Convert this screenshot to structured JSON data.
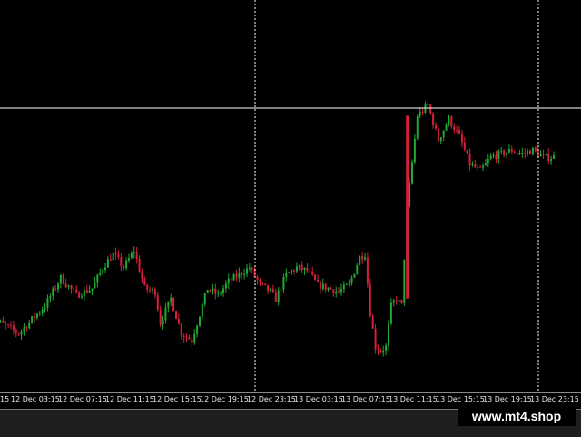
{
  "colors": {
    "background": "#000000",
    "bull": "#22a832",
    "bear": "#d81e3c",
    "grid": "#ffffff",
    "crosshair": "#ffffff",
    "axis_text": "#e6e6e6"
  },
  "chart_data": {
    "type": "candlestick",
    "x_tick_labels": [
      "12 Dec 03:15",
      "12 Dec 07:15",
      "12 Dec 11:15",
      "12 Dec 15:15",
      "12 Dec 19:15",
      "12 Dec 23:15",
      "13 Dec 03:15",
      "13 Dec 07:15",
      "13 Dec 11:15",
      "13 Dec 15:15",
      "13 Dec 19:15",
      "13 Dec 23:15"
    ],
    "x_tick_label_partial_left": "15",
    "period_separators": [
      "12 Dec 23:15",
      "13 Dec 23:15"
    ],
    "crosshair_visible": true,
    "grid": false,
    "price_trace": [
      {
        "t": 0,
        "v": 19
      },
      {
        "t": 6,
        "v": 14
      },
      {
        "t": 11,
        "v": 22
      },
      {
        "t": 14,
        "v": 30
      },
      {
        "t": 17,
        "v": 25
      },
      {
        "t": 20,
        "v": 27
      },
      {
        "t": 22,
        "v": 33
      },
      {
        "t": 24,
        "v": 37
      },
      {
        "t": 26,
        "v": 33
      },
      {
        "t": 28,
        "v": 38
      },
      {
        "t": 30,
        "v": 27
      },
      {
        "t": 32,
        "v": 26
      },
      {
        "t": 33,
        "v": 17
      },
      {
        "t": 35,
        "v": 24
      },
      {
        "t": 37,
        "v": 14
      },
      {
        "t": 39,
        "v": 12
      },
      {
        "t": 41,
        "v": 22
      },
      {
        "t": 42,
        "v": 27
      },
      {
        "t": 44,
        "v": 25
      },
      {
        "t": 46,
        "v": 29
      },
      {
        "t": 48,
        "v": 31
      },
      {
        "t": 50,
        "v": 33
      },
      {
        "t": 52,
        "v": 28
      },
      {
        "t": 54,
        "v": 26
      },
      {
        "t": 55,
        "v": 24
      },
      {
        "t": 57,
        "v": 31
      },
      {
        "t": 59,
        "v": 33
      },
      {
        "t": 61,
        "v": 32
      },
      {
        "t": 63,
        "v": 28
      },
      {
        "t": 65,
        "v": 27
      },
      {
        "t": 67,
        "v": 26
      },
      {
        "t": 69,
        "v": 28
      },
      {
        "t": 70,
        "v": 32
      },
      {
        "t": 71,
        "v": 36
      },
      {
        "t": 72,
        "v": 37
      },
      {
        "t": 73,
        "v": 20
      },
      {
        "t": 74,
        "v": 10
      },
      {
        "t": 75,
        "v": 9
      },
      {
        "t": 76,
        "v": 10
      },
      {
        "t": 77,
        "v": 22
      },
      {
        "t": 78,
        "v": 24
      },
      {
        "t": 79,
        "v": 22
      },
      {
        "t": 80,
        "v": 50
      },
      {
        "t": 82,
        "v": 77
      },
      {
        "t": 84,
        "v": 80
      },
      {
        "t": 86,
        "v": 70
      },
      {
        "t": 88,
        "v": 76
      },
      {
        "t": 90,
        "v": 71
      },
      {
        "t": 92,
        "v": 63
      },
      {
        "t": 94,
        "v": 61
      },
      {
        "t": 96,
        "v": 65
      },
      {
        "t": 98,
        "v": 66
      },
      {
        "t": 100,
        "v": 67
      },
      {
        "t": 102,
        "v": 66
      },
      {
        "t": 104,
        "v": 67
      },
      {
        "t": 106,
        "v": 65
      },
      {
        "t": 108,
        "v": 65
      }
    ]
  },
  "watermark": "www.mt4.shop"
}
